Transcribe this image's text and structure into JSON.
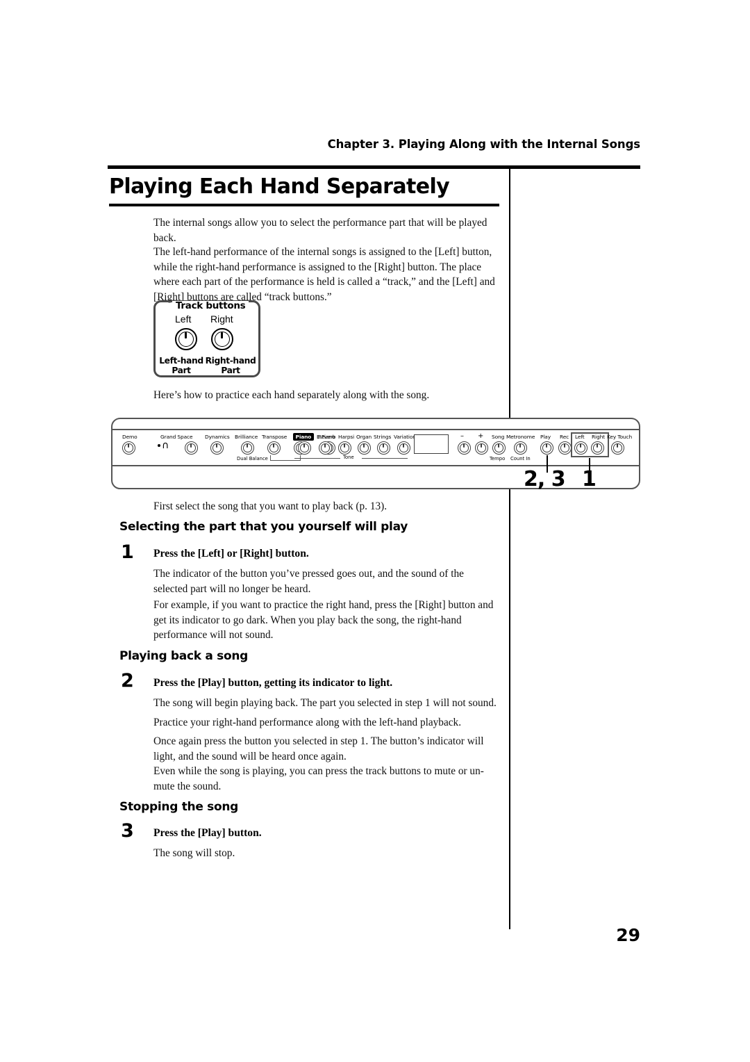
{
  "header": {
    "chapter": "Chapter 3. Playing Along with the Internal Songs"
  },
  "title": "Playing Each Hand Separately",
  "intro": {
    "p1": "The internal songs allow you to select the performance part that will be played back.",
    "p2": "The left-hand performance of the internal songs is assigned to the [Left] button, while the right-hand performance is assigned to the [Right] button. The place where each part of the performance is held is called a “track,” and the [Left] and [Right] buttons are called “track buttons.”",
    "p3": "Here’s how to practice each hand separately along with the song."
  },
  "track_callout": {
    "title": "Track buttons",
    "left_label": "Left",
    "right_label": "Right",
    "left_part": "Left-hand\nPart",
    "left_part_line1": "Left-hand",
    "left_part_line2": "Part",
    "right_part_line1": "Right-hand",
    "right_part_line2": "Part"
  },
  "panel": {
    "labels": {
      "demo": "Demo",
      "grand_space": "Grand Space",
      "dynamics": "Dynamics",
      "brilliance": "Brilliance",
      "transpose": "Transpose",
      "split": "Split",
      "reverb": "Reverb",
      "piano": "Piano",
      "epiano": "E.Piano",
      "harpsi": "Harpsi",
      "organ": "Organ",
      "strings": "Strings",
      "variation": "Variation",
      "minus": "–",
      "plus": "+",
      "song": "Song",
      "metronome": "Metronome",
      "play": "Play",
      "rec": "Rec",
      "left": "Left",
      "right": "Right",
      "key_touch": "Key Touch"
    },
    "sublabels": {
      "dual_balance": "Dual Balance",
      "tone": "Tone",
      "tempo": "Tempo",
      "count_in": "Count In"
    },
    "callouts": {
      "play_steps": "2, 3",
      "track_step": "1"
    }
  },
  "body": {
    "first_select": "First select the song that you want to play back (p. 13)."
  },
  "sections": [
    {
      "heading": "Selecting the part that you yourself will play",
      "step_number": "1",
      "step_title": "Press the [Left] or [Right] button.",
      "paragraphs": [
        "The indicator of the button you’ve pressed goes out, and the sound of the selected part will no longer be heard.",
        "For example, if you want to practice the right hand, press the [Right] button and get its indicator to go dark. When you play back the song, the right-hand performance will not sound."
      ]
    },
    {
      "heading": "Playing back a song",
      "step_number": "2",
      "step_title": "Press the [Play] button, getting its indicator to light.",
      "paragraphs": [
        "The song will begin playing back. The part you selected in step 1 will not sound.",
        "Practice your right-hand performance along with the left-hand playback.",
        "Once again press the button you selected in step 1. The button’s indicator will light, and the sound will be heard once again.",
        "Even while the song is playing, you can press the track buttons to mute or un-mute the sound."
      ]
    },
    {
      "heading": "Stopping the song",
      "step_number": "3",
      "step_title": "Press the [Play] button.",
      "paragraphs": [
        "The song will stop."
      ]
    }
  ],
  "folio": "29"
}
